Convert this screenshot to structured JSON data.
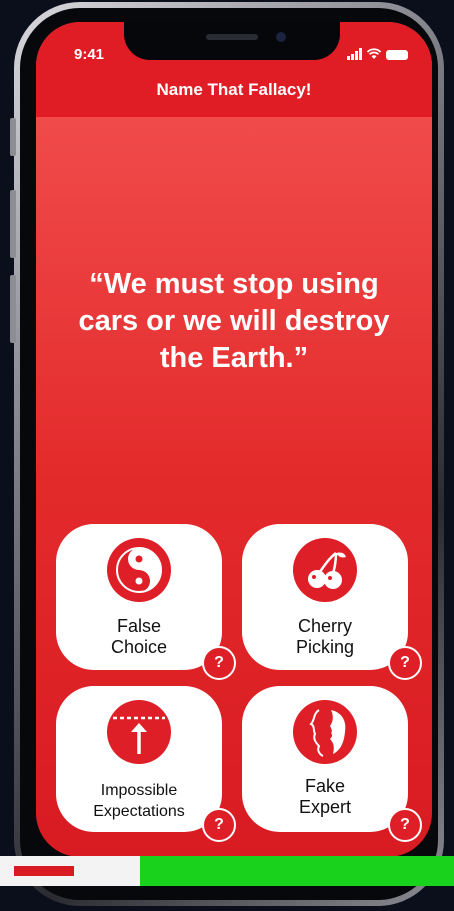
{
  "status_bar": {
    "time": "9:41"
  },
  "header": {
    "title": "Name That Fallacy!"
  },
  "quote": "“We must stop using cars or we will destroy the Earth.”",
  "options": [
    {
      "line1": "False",
      "line2": "Choice",
      "icon": "yin-yang-icon"
    },
    {
      "line1": "Cherry",
      "line2": "Picking",
      "icon": "cherry-icon"
    },
    {
      "line1": "Impossible",
      "line2": "Expectations",
      "icon": "arrow-up-limit-icon"
    },
    {
      "line1": "Fake",
      "line2": "Expert",
      "icon": "face-profile-icon"
    }
  ],
  "help_label": "?",
  "colors": {
    "accent": "#df1f27",
    "background_top": "#f45353",
    "background_bottom": "#d81b22"
  }
}
